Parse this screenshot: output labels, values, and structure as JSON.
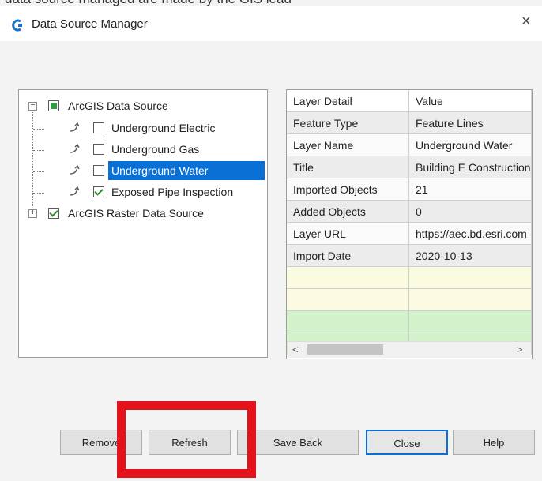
{
  "window": {
    "title": "Data Source Manager",
    "top_caption": "data source managed are made by the GIS lead"
  },
  "tree": {
    "items": [
      {
        "label": "ArcGIS Data Source",
        "checkbox": "partial",
        "expander": "minus"
      },
      {
        "label": "Underground Electric",
        "checkbox": "unchecked"
      },
      {
        "label": "Underground Gas",
        "checkbox": "unchecked"
      },
      {
        "label": "Underground Water",
        "checkbox": "unchecked",
        "selected": true
      },
      {
        "label": "Exposed Pipe Inspection",
        "checkbox": "checked"
      },
      {
        "label": "ArcGIS Raster Data Source",
        "checkbox": "checked",
        "expander": "plus"
      }
    ]
  },
  "grid": {
    "header": {
      "detail": "Layer Detail",
      "value": "Value"
    },
    "rows": [
      {
        "detail": "Feature Type",
        "value": "Feature Lines"
      },
      {
        "detail": "Layer Name",
        "value": "Underground Water"
      },
      {
        "detail": "Title",
        "value": "Building E Construction"
      },
      {
        "detail": "Imported Objects",
        "value": "21"
      },
      {
        "detail": "Added Objects",
        "value": "0"
      },
      {
        "detail": "Layer URL",
        "value": "https://aec.bd.esri.com"
      },
      {
        "detail": "Import Date",
        "value": "2020-10-13"
      }
    ],
    "scroll_left": "<",
    "scroll_right": ">"
  },
  "buttons": {
    "remove": "Remove",
    "refresh": "Refresh",
    "save_back": "Save Back",
    "close": "Close",
    "help": "Help"
  },
  "icons": {
    "close": "×",
    "expand_minus": "−",
    "expand_plus": "+"
  },
  "colors": {
    "selection": "#0a70d6",
    "highlight_box": "#e3121b",
    "yellow_rows": "#fbfbe1",
    "green_rows": "#d2f2cc"
  }
}
